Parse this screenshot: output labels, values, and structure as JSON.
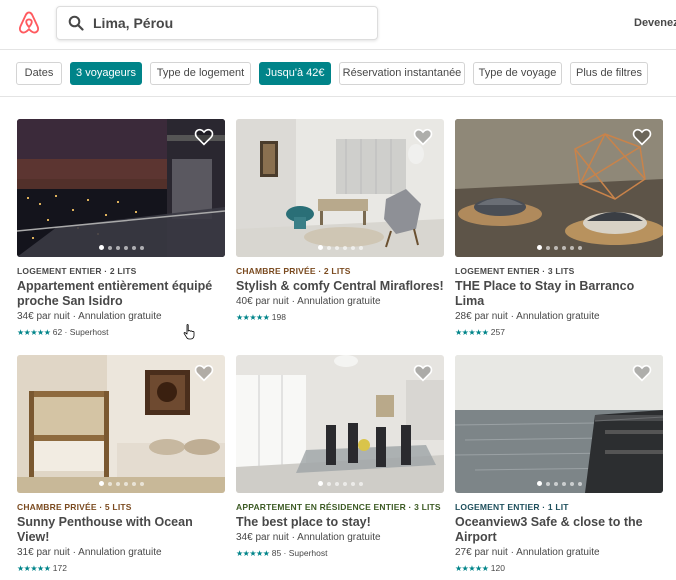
{
  "header": {
    "logo": "airbnb-logo",
    "search_icon": "search-icon",
    "search_value": "Lima, Pérou",
    "link_label": "Devenez"
  },
  "filters": [
    {
      "label": "Dates",
      "active": false
    },
    {
      "label": "3 voyageurs",
      "active": true
    },
    {
      "label": "Type de logement",
      "active": false
    },
    {
      "label": "Jusqu'à 42€",
      "active": true
    },
    {
      "label": "Réservation instantanée",
      "active": false
    },
    {
      "label": "Type de voyage",
      "active": false
    },
    {
      "label": "Plus de filtres",
      "active": false
    }
  ],
  "colors": {
    "brand": "#FF5A5F",
    "accent": "#008489",
    "kind_entire": "#484848",
    "kind_private": "#7A4A1F",
    "kind_residence": "#3D5B25",
    "kind_ocean": "#1E4F5C"
  },
  "listings": [
    {
      "kind": "Logement entier · 2 lits",
      "kind_color": "#484848",
      "title": "Appartement entièrement équipé proche San Isidro",
      "price": "34€ par nuit · Annulation gratuite",
      "stars": "★★★★★",
      "reviews": "62 · Superhost",
      "photo": "night-city-balcony",
      "dots": 6
    },
    {
      "kind": "Chambre privée · 2 lits",
      "kind_color": "#7A4A1F",
      "title": "Stylish & comfy Central Miraflores!",
      "price": "40€ par nuit · Annulation gratuite",
      "stars": "★★★★★",
      "reviews": "198",
      "photo": "living-room",
      "dots": 6
    },
    {
      "kind": "Logement entier · 3 lits",
      "kind_color": "#484848",
      "title": "THE Place to Stay in Barranco Lima",
      "price": "28€ par nuit · Annulation gratuite",
      "stars": "★★★★★",
      "reviews": "257",
      "photo": "table-bowls",
      "dots": 6
    },
    {
      "kind": "Chambre privée · 5 lits",
      "kind_color": "#7A4A1F",
      "title": "Sunny Penthouse with Ocean View!",
      "price": "31€ par nuit · Annulation gratuite",
      "stars": "★★★★★",
      "reviews": "172",
      "photo": "bunk-bedroom",
      "dots": 6
    },
    {
      "kind": "Appartement en résidence entier · 3 lits",
      "kind_color": "#3D5B25",
      "title": "The best place to stay!",
      "price": "34€ par nuit · Annulation gratuite",
      "stars": "★★★★★",
      "reviews": "85 · Superhost",
      "photo": "dining-room",
      "dots": 6
    },
    {
      "kind": "Logement entier · 1 lit",
      "kind_color": "#1E4F5C",
      "title": "Oceanview3 Safe & close to the Airport",
      "price": "27€ par nuit · Annulation gratuite",
      "stars": "★★★★★",
      "reviews": "120",
      "photo": "ocean-terrace",
      "dots": 6
    }
  ],
  "cursor_icon": "pointer-hand-icon"
}
